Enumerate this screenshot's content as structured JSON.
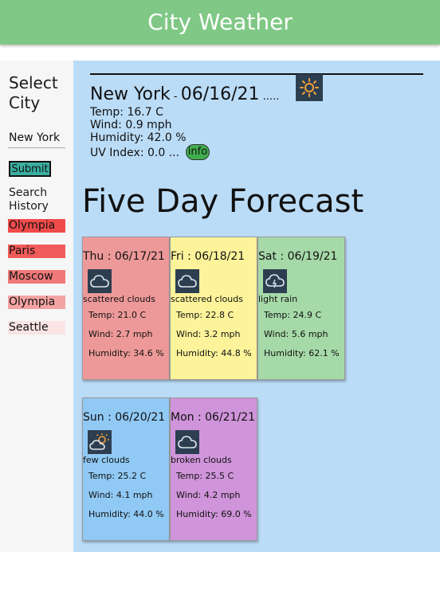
{
  "header": {
    "title": "City Weather"
  },
  "sidebar": {
    "select_title": "Select City",
    "city_input_value": "New York",
    "submit_label": "Submit",
    "history_title": "Search History",
    "history": [
      {
        "city": "Olympia",
        "color": "#f04b4b"
      },
      {
        "city": "Paris",
        "color": "#f25b5b"
      },
      {
        "city": "Moscow",
        "color": "#f07878"
      },
      {
        "city": "Olympia",
        "color": "#f4a3a3"
      },
      {
        "city": "Seattle",
        "color": "#fbe4e4"
      }
    ]
  },
  "current": {
    "city": "New York",
    "separator": " - ",
    "date": "06/16/21",
    "dots": " .....",
    "icon": "sun-icon",
    "temp": "Temp: 16.7 C",
    "wind": "Wind: 0.9 mph",
    "humidity": "Humidity: 42.0 %",
    "uv": "UV Index: 0.0 ...",
    "info_label": "info"
  },
  "forecast_title": "Five Day Forecast",
  "forecast": [
    {
      "date": "Thu : 06/17/21",
      "icon": "cloud-icon",
      "desc": "scattered clouds",
      "temp": "Temp: 21.0 C",
      "wind": "Wind: 2.7 mph",
      "humidity": "Humidity: 34.6 %",
      "color": "#ee9999"
    },
    {
      "date": "Fri : 06/18/21",
      "icon": "cloud-icon",
      "desc": "scattered clouds",
      "temp": "Temp: 22.8 C",
      "wind": "Wind: 3.2 mph",
      "humidity": "Humidity: 44.8 %",
      "color": "#fdf39a"
    },
    {
      "date": "Sat : 06/19/21",
      "icon": "rain-cloud-icon",
      "desc": "light rain",
      "temp": "Temp: 24.9 C",
      "wind": "Wind: 5.6 mph",
      "humidity": "Humidity: 62.1 %",
      "color": "#a6d9a8"
    },
    {
      "date": "Sun : 06/20/21",
      "icon": "sun-cloud-icon",
      "desc": "few clouds",
      "temp": "Temp: 25.2 C",
      "wind": "Wind: 4.1 mph",
      "humidity": "Humidity: 44.0 %",
      "color": "#90c9f4"
    },
    {
      "date": "Mon : 06/21/21",
      "icon": "cloud-icon",
      "desc": "broken clouds",
      "temp": "Temp: 25.5 C",
      "wind": "Wind: 4.2 mph",
      "humidity": "Humidity: 69.0 %",
      "color": "#cf94d9"
    }
  ]
}
